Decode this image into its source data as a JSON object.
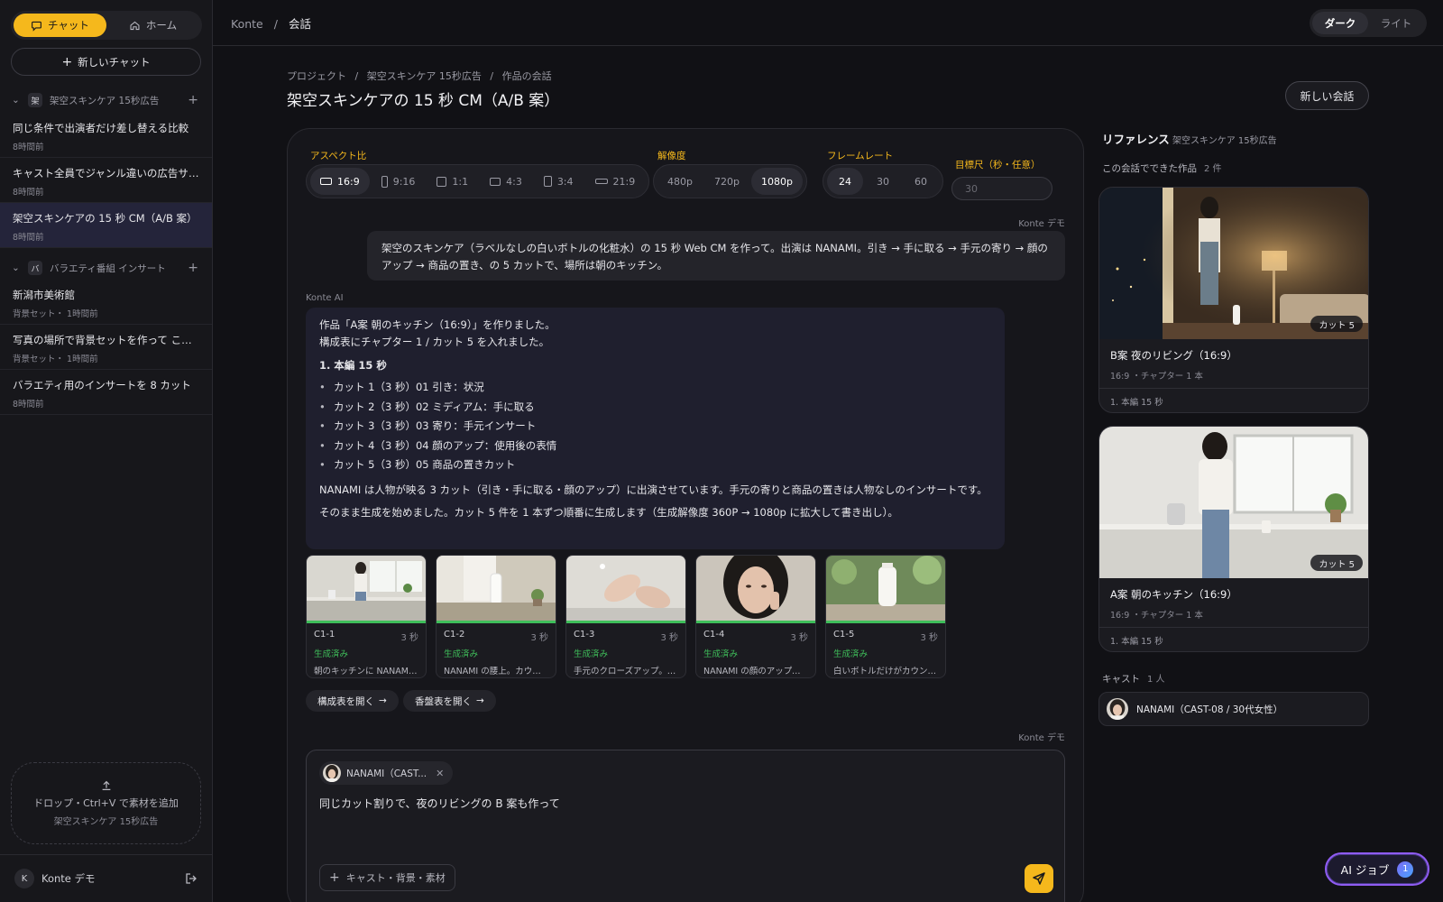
{
  "sidebar": {
    "tabs": [
      {
        "label": "チャット"
      },
      {
        "label": "ホーム"
      }
    ],
    "new_chat": "新しいチャット",
    "groups": [
      {
        "badge": "架",
        "name": "架空スキンケア 15秒広告",
        "items": [
          {
            "title": "同じ条件で出演者だけ差し替える比較",
            "sub": "8時間前"
          },
          {
            "title": "キャスト全員でジャンル違いの広告サンプル",
            "sub": "8時間前"
          },
          {
            "title": "架空スキンケアの 15 秒 CM（A/B 案）",
            "sub": "8時間前"
          }
        ]
      },
      {
        "badge": "バ",
        "name": "バラエティ番組 インサート",
        "items": [
          {
            "title": "新潟市美術館",
            "sub": "背景セット・ 1時間前"
          },
          {
            "title": "写真の場所で背景セットを作って これを使って",
            "sub": "背景セット・ 1時間前"
          },
          {
            "title": "バラエティ用のインサートを 8 カット",
            "sub": "8時間前"
          }
        ]
      }
    ],
    "dropzone": {
      "title": "ドロップ・Ctrl+V で素材を追加",
      "sub": "架空スキンケア 15秒広告"
    },
    "user": {
      "initial": "K",
      "name": "Konte デモ"
    }
  },
  "topbar": {
    "app": "Konte",
    "sep": "/",
    "page": "会話",
    "theme": [
      {
        "label": "ダーク"
      },
      {
        "label": "ライト"
      }
    ]
  },
  "page": {
    "breadcrumb": [
      "プロジェクト",
      "架空スキンケア 15秒広告",
      "作品の会話"
    ],
    "sep": "/",
    "title": "架空スキンケアの 15 秒 CM（A/B 案）",
    "new_conversation": "新しい会話"
  },
  "settings": {
    "aspect": {
      "label": "アスペクト比",
      "options": [
        "16:9",
        "9:16",
        "1:1",
        "4:3",
        "3:4",
        "21:9"
      ],
      "selected": "16:9"
    },
    "resolution": {
      "label": "解像度",
      "options": [
        "480p",
        "720p",
        "1080p"
      ],
      "selected": "1080p"
    },
    "framerate": {
      "label": "フレームレート",
      "options": [
        "24",
        "30",
        "60"
      ],
      "selected": "24"
    },
    "target": {
      "label": "目標尺（秒・任意）",
      "placeholder": "30"
    }
  },
  "chat": {
    "user_label": "Konte デモ",
    "user_message": "架空のスキンケア（ラベルなしの白いボトルの化粧水）の 15 秒 Web CM を作って。出演は NANAMI。引き → 手に取る → 手元の寄り → 顔のアップ → 商品の置き、の 5 カットで、場所は朝のキッチン。",
    "ai_label": "Konte AI",
    "ai": {
      "line1": "作品「A案 朝のキッチン（16:9）」を作りました。",
      "line2": "構成表にチャプター 1 / カット 5 を入れました。",
      "heading": "1. 本編 15 秒",
      "cuts": [
        "カット 1（3 秒）01 引き：状況",
        "カット 2（3 秒）02 ミディアム：手に取る",
        "カット 3（3 秒）03 寄り：手元インサート",
        "カット 4（3 秒）04 顔のアップ：使用後の表情",
        "カット 5（3 秒）05 商品の置きカット"
      ],
      "para1": "NANAMI は人物が映る 3 カット（引き・手に取る・顔のアップ）に出演させています。手元の寄りと商品の置きは人物なしのインサートです。",
      "para2": "そのまま生成を始めました。カット 5 件を 1 本ずつ順番に生成します（生成解像度 360P → 1080p に拡大して書き出し）。"
    },
    "thumbnails": [
      {
        "id": "C1-1",
        "dur": "3 秒",
        "status": "生成済み",
        "desc": "朝のキッチンに NANAMI が立つ引きの状況カット"
      },
      {
        "id": "C1-2",
        "dur": "3 秒",
        "status": "生成済み",
        "desc": "NANAMI の腰上。カウンターのボトルを手に取る"
      },
      {
        "id": "C1-3",
        "dur": "3 秒",
        "status": "生成済み",
        "desc": "手元のクローズアップ。化粧水を手に取る"
      },
      {
        "id": "C1-4",
        "dur": "3 秒",
        "status": "生成済み",
        "desc": "NANAMI の顔のアップ。使用後の表情"
      },
      {
        "id": "C1-5",
        "dur": "3 秒",
        "status": "生成済み",
        "desc": "白いボトルだけがカウンターに置かれる"
      }
    ],
    "actions": [
      "構成表を開く",
      "香盤表を開く"
    ],
    "second_user_label": "Konte デモ"
  },
  "composer": {
    "cast_chip": "NANAMI（CAST...",
    "message": "同じカット割りで、夜のリビングの B 案も作って",
    "add_button": "キャスト・背景・素材"
  },
  "right": {
    "title": "リファレンス",
    "subtitle": "架空スキンケア 15秒広告",
    "works_label": "この会話でできた作品",
    "works_count": "2 件",
    "works": [
      {
        "title": "B案 夜のリビング（16:9）",
        "sub": "16:9 ・チャプター 1 本",
        "badge": "カット 5",
        "chapter": "1. 本編 15 秒"
      },
      {
        "title": "A案 朝のキッチン（16:9）",
        "sub": "16:9 ・チャプター 1 本",
        "badge": "カット 5",
        "chapter": "1. 本編 15 秒"
      }
    ],
    "cast_label": "キャスト",
    "cast_count": "1 人",
    "cast": [
      {
        "name": "NANAMI（CAST-08 / 30代女性）"
      }
    ]
  },
  "ai_job": {
    "label": "AI ジョブ",
    "count": "1"
  },
  "colors": {
    "accent": "#f5b81c",
    "success": "#3fbe5a",
    "job": "#8f5cf2"
  }
}
